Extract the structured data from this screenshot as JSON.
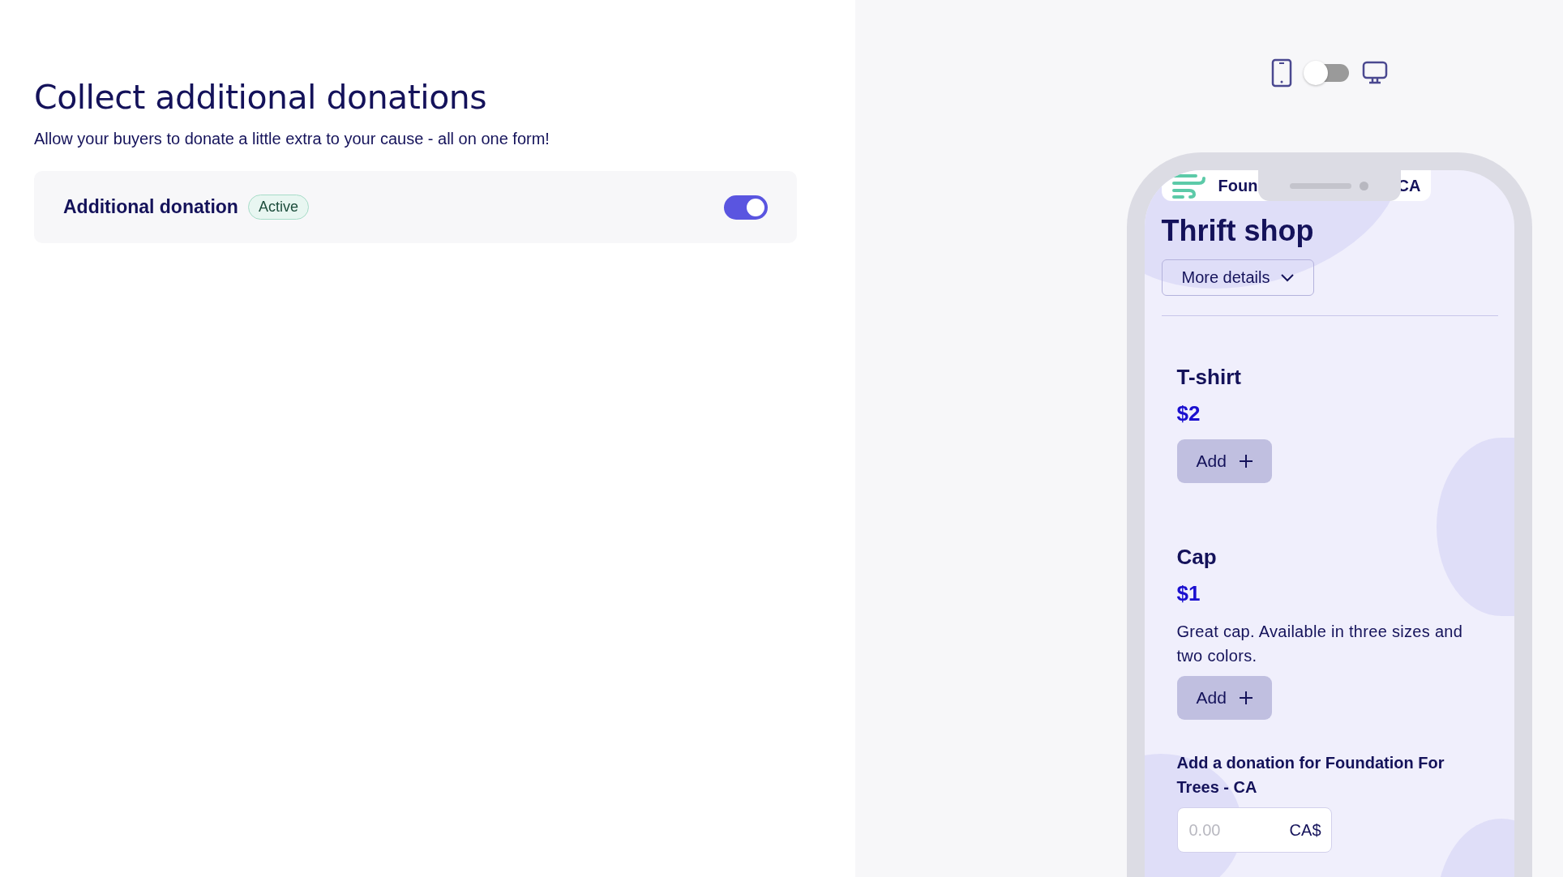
{
  "page": {
    "title": "Collect additional donations",
    "subtitle": "Allow your buyers to donate a little extra to your cause - all on one form!"
  },
  "setting": {
    "label": "Additional donation",
    "badge": "Active",
    "on": true
  },
  "preview": {
    "device_toggle": {
      "on": false
    },
    "org_name_start": "Foun",
    "org_name_end": "CA",
    "shop_title": "Thrift shop",
    "details_button": "More details",
    "products": [
      {
        "name": "T-shirt",
        "price": "$2",
        "add_label": "Add"
      },
      {
        "name": "Cap",
        "price": "$1",
        "description": "Great cap. Available in three sizes and two colors.",
        "add_label": "Add"
      }
    ],
    "donation": {
      "label": "Add a donation for Foundation For Trees - CA",
      "placeholder": "0.00",
      "currency": "CA$"
    }
  }
}
